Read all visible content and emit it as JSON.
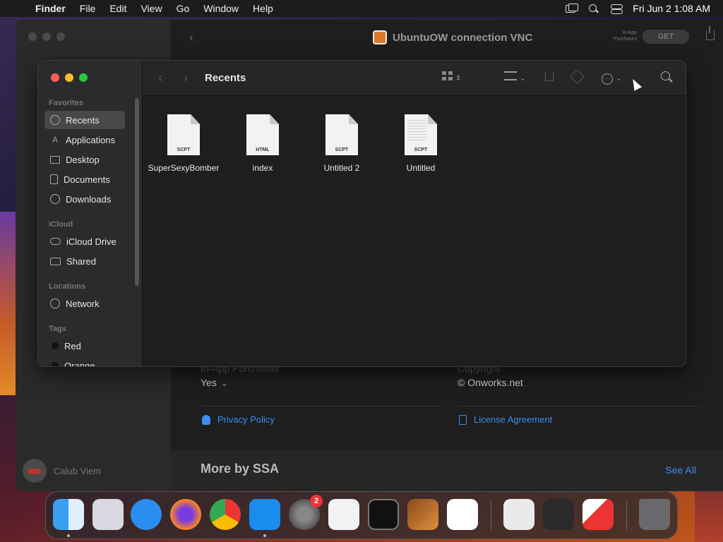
{
  "menubar": {
    "app_name": "Finder",
    "menus": [
      "File",
      "Edit",
      "View",
      "Go",
      "Window",
      "Help"
    ],
    "clock": "Fri Jun 2  1:08 AM"
  },
  "background_window": {
    "title": "UbuntuOW connection VNC",
    "iap_label": "In-App Purchases",
    "get_button": "GET",
    "iap_heading": "In-App Purchases",
    "iap_value": "Yes",
    "copyright_heading": "Copyright",
    "copyright_value": "© Onworks.net",
    "privacy_link": "Privacy Policy",
    "license_link": "License Agreement",
    "more_by": "More by SSA",
    "see_all": "See All",
    "user_name": "Calub Viem"
  },
  "finder": {
    "title": "Recents",
    "sidebar": {
      "favorites_title": "Favorites",
      "favorites": [
        "Recents",
        "Applications",
        "Desktop",
        "Documents",
        "Downloads"
      ],
      "icloud_title": "iCloud",
      "icloud": [
        "iCloud Drive",
        "Shared"
      ],
      "locations_title": "Locations",
      "locations": [
        "Network"
      ],
      "tags_title": "Tags",
      "tags": [
        "Red",
        "Orange"
      ]
    },
    "files": [
      {
        "name": "SuperSexyBomber",
        "ext": "SCPT"
      },
      {
        "name": "index",
        "ext": "HTML"
      },
      {
        "name": "Untitled 2",
        "ext": "SCPT"
      },
      {
        "name": "Untitled",
        "ext": "SCPT"
      }
    ]
  },
  "dock": {
    "apps": [
      "finder",
      "launchpad",
      "safari",
      "firefox",
      "chrome",
      "app-store",
      "system-settings",
      "textedit",
      "terminal",
      "garageband",
      "vscode",
      "script-editor",
      "voice-memos",
      "vnc-viewer",
      "trash"
    ],
    "system_settings_badge": "2",
    "colors": {
      "accent_link": "#3b8ef0",
      "badge": "#e33333"
    }
  }
}
